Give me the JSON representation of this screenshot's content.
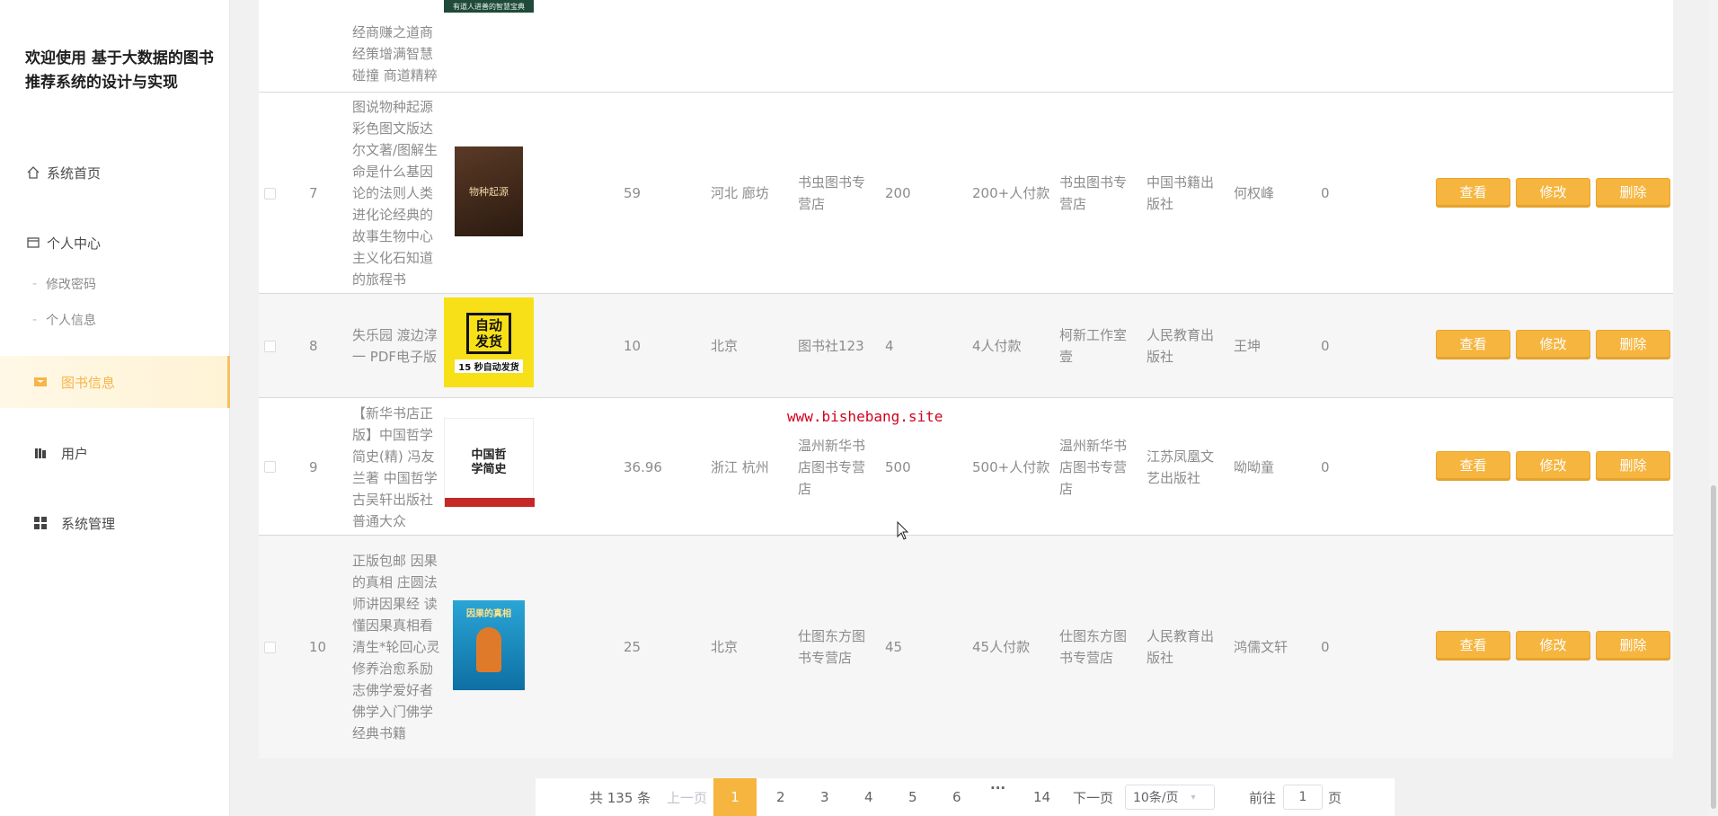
{
  "sidebar": {
    "title": "欢迎使用 基于大数据的图书推荐系统的设计与实现",
    "items": [
      {
        "label": "系统首页"
      },
      {
        "label": "个人中心"
      },
      {
        "label": "修改密码"
      },
      {
        "label": "个人信息"
      },
      {
        "label": "图书信息"
      },
      {
        "label": "用户"
      },
      {
        "label": "系统管理"
      }
    ]
  },
  "table": {
    "partial_top_row": {
      "name": "经商赚之道商经策增满智慧碰撞 商道精粹",
      "cover_text": "有道人进善的智慧宝典"
    },
    "rows": [
      {
        "index": "7",
        "name": "图说物种起源彩色图文版达尔文著/图解生命是什么基因论的法则人类进化论经典的故事生物中心主义化石知道的旅程书",
        "cover_text": "物种起源",
        "price": "59",
        "location": "河北 廊坊",
        "shop": "书虫图书专营店",
        "stock": "200",
        "paid": "200+人付款",
        "seller": "书虫图书专营店",
        "publisher": "中国书籍出版社",
        "author": "何权峰",
        "clicks": "0"
      },
      {
        "index": "8",
        "name": "失乐园 渡边淳一 PDF电子版",
        "cover_text": "自动发货",
        "cover_subtext": "15 秒自动发货",
        "price": "10",
        "location": "北京",
        "shop": "图书社123",
        "stock": "4",
        "paid": "4人付款",
        "seller": "柯新工作室壹",
        "publisher": "人民教育出版社",
        "author": "王坤",
        "clicks": "0"
      },
      {
        "index": "9",
        "name": "【新华书店正版】中国哲学简史(精) 冯友兰著 中国哲学古吴轩出版社普通大众",
        "cover_text": "中国哲学简史",
        "price": "36.96",
        "location": "浙江 杭州",
        "shop": "温州新华书店图书专营店",
        "stock": "500",
        "paid": "500+人付款",
        "seller": "温州新华书店图书专营店",
        "publisher": "江苏凤凰文艺出版社",
        "author": "呦呦童",
        "clicks": "0"
      },
      {
        "index": "10",
        "name": "正版包邮 因果的真相 庄圆法师讲因果经 读懂因果真相看清生*轮回心灵修养治愈系励志佛学爱好者佛学入门佛学经典书籍",
        "cover_text": "因果的真相",
        "price": "25",
        "location": "北京",
        "shop": "仕图东方图书专营店",
        "stock": "45",
        "paid": "45人付款",
        "seller": "仕图东方图书专营店",
        "publisher": "人民教育出版社",
        "author": "鸿儒文轩",
        "clicks": "0"
      }
    ],
    "actions": {
      "view": "查看",
      "edit": "修改",
      "delete": "删除"
    }
  },
  "watermark": "www.bishebang.site",
  "pagination": {
    "total": "共 135 条",
    "prev": "上一页",
    "pages": [
      "1",
      "2",
      "3",
      "4",
      "5",
      "6"
    ],
    "ellipsis": "···",
    "last": "14",
    "next": "下一页",
    "page_size": "10条/页",
    "goto_label": "前往",
    "goto_value": "1",
    "goto_suffix": "页"
  },
  "colors": {
    "accent": "#f6b53f",
    "active_bg": "#fff5dd",
    "watermark": "#d0021b"
  }
}
